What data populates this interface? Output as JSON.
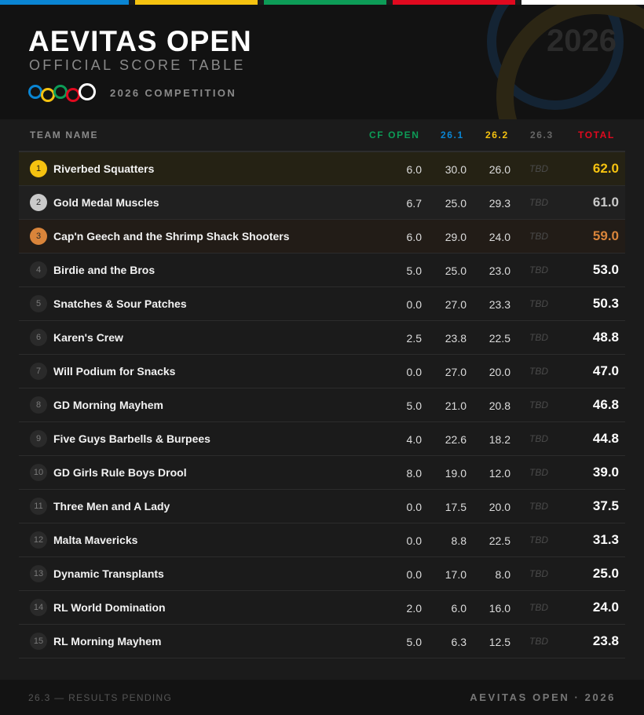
{
  "header": {
    "title": "AEVITAS OPEN",
    "subtitle": "OFFICIAL SCORE TABLE",
    "competition": "2026 COMPETITION",
    "year_watermark": "2026"
  },
  "colors": {
    "blue": "#0a85d3",
    "yellow": "#f5c210",
    "green": "#0d9c57",
    "red": "#e0091f",
    "white": "#ffffff",
    "gold": "#f5c210",
    "silver": "#c9c9c9",
    "bronze": "#d9843a"
  },
  "table": {
    "columns": {
      "team": "TEAM NAME",
      "cf_open": "CF OPEN",
      "w261": "26.1",
      "w262": "26.2",
      "w263": "26.3",
      "total": "TOTAL"
    },
    "rows": [
      {
        "rank": "1",
        "team": "Riverbed Squatters",
        "cf": "6.0",
        "w1": "30.0",
        "w2": "26.0",
        "w3": "TBD",
        "total": "62.0"
      },
      {
        "rank": "2",
        "team": "Gold Medal Muscles",
        "cf": "6.7",
        "w1": "25.0",
        "w2": "29.3",
        "w3": "TBD",
        "total": "61.0"
      },
      {
        "rank": "3",
        "team": "Cap'n Geech and the Shrimp Shack Shooters",
        "cf": "6.0",
        "w1": "29.0",
        "w2": "24.0",
        "w3": "TBD",
        "total": "59.0"
      },
      {
        "rank": "4",
        "team": "Birdie and the Bros",
        "cf": "5.0",
        "w1": "25.0",
        "w2": "23.0",
        "w3": "TBD",
        "total": "53.0"
      },
      {
        "rank": "5",
        "team": "Snatches & Sour Patches",
        "cf": "0.0",
        "w1": "27.0",
        "w2": "23.3",
        "w3": "TBD",
        "total": "50.3"
      },
      {
        "rank": "6",
        "team": "Karen's Crew",
        "cf": "2.5",
        "w1": "23.8",
        "w2": "22.5",
        "w3": "TBD",
        "total": "48.8"
      },
      {
        "rank": "7",
        "team": "Will Podium for Snacks",
        "cf": "0.0",
        "w1": "27.0",
        "w2": "20.0",
        "w3": "TBD",
        "total": "47.0"
      },
      {
        "rank": "8",
        "team": "GD Morning Mayhem",
        "cf": "5.0",
        "w1": "21.0",
        "w2": "20.8",
        "w3": "TBD",
        "total": "46.8"
      },
      {
        "rank": "9",
        "team": "Five Guys Barbells & Burpees",
        "cf": "4.0",
        "w1": "22.6",
        "w2": "18.2",
        "w3": "TBD",
        "total": "44.8"
      },
      {
        "rank": "10",
        "team": "GD Girls Rule Boys Drool",
        "cf": "8.0",
        "w1": "19.0",
        "w2": "12.0",
        "w3": "TBD",
        "total": "39.0"
      },
      {
        "rank": "11",
        "team": "Three Men and A Lady",
        "cf": "0.0",
        "w1": "17.5",
        "w2": "20.0",
        "w3": "TBD",
        "total": "37.5"
      },
      {
        "rank": "12",
        "team": "Malta Mavericks",
        "cf": "0.0",
        "w1": "8.8",
        "w2": "22.5",
        "w3": "TBD",
        "total": "31.3"
      },
      {
        "rank": "13",
        "team": "Dynamic Transplants",
        "cf": "0.0",
        "w1": "17.0",
        "w2": "8.0",
        "w3": "TBD",
        "total": "25.0"
      },
      {
        "rank": "14",
        "team": "RL World Domination",
        "cf": "2.0",
        "w1": "6.0",
        "w2": "16.0",
        "w3": "TBD",
        "total": "24.0"
      },
      {
        "rank": "15",
        "team": "RL Morning Mayhem",
        "cf": "5.0",
        "w1": "6.3",
        "w2": "12.5",
        "w3": "TBD",
        "total": "23.8"
      }
    ]
  },
  "footer": {
    "left": "26.3 — RESULTS PENDING",
    "right": "AEVITAS OPEN · 2026"
  }
}
